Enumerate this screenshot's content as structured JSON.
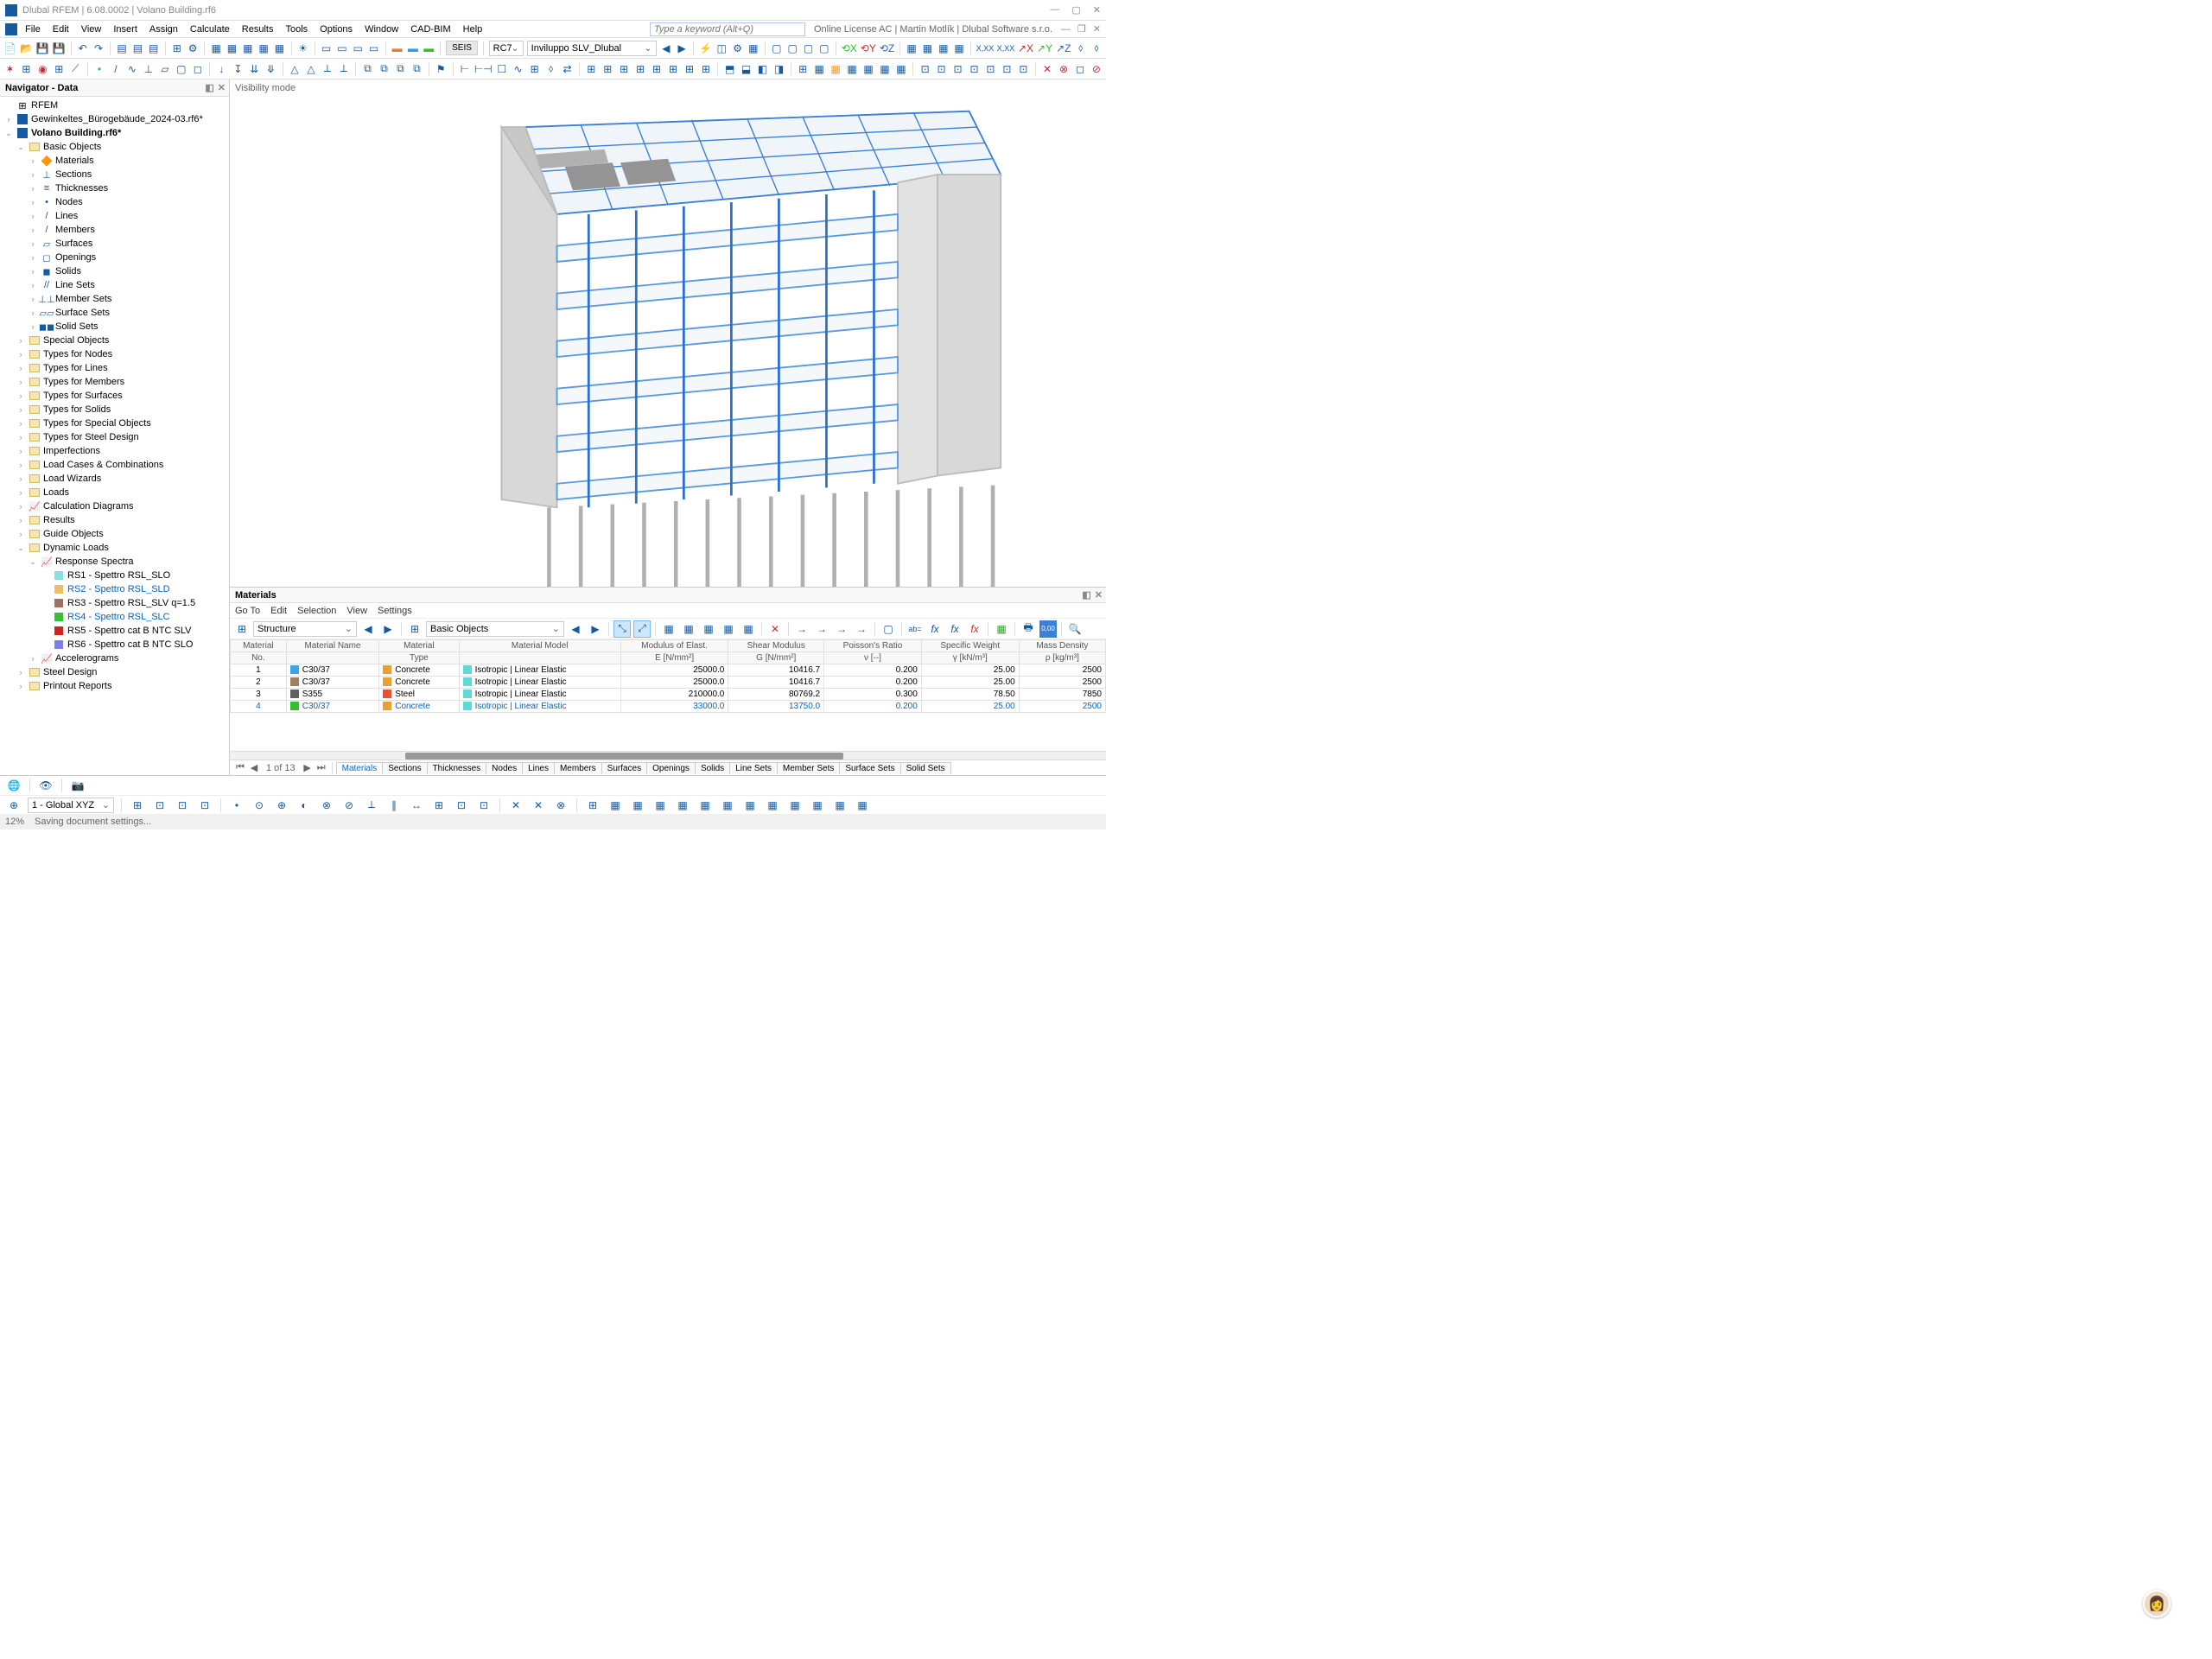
{
  "title": "Dlubal RFEM | 6.08.0002 | Volano Building.rf6",
  "menu": [
    "File",
    "Edit",
    "View",
    "Insert",
    "Assign",
    "Calculate",
    "Results",
    "Tools",
    "Options",
    "Window",
    "CAD-BIM",
    "Help"
  ],
  "keyword_placeholder": "Type a keyword (Alt+Q)",
  "license_info": "Online License AC | Martin Motlík | Dlubal Software s.r.o.",
  "tb1": {
    "seis": "SEIS",
    "rc7": "RC7",
    "combo": "Inviluppo SLV_Dlubal"
  },
  "navigator": {
    "title": "Navigator - Data",
    "root": "RFEM",
    "file1": "Gewinkeltes_Bürogebäude_2024-03.rf6*",
    "file2": "Volano Building.rf6*",
    "basic_objects": "Basic Objects",
    "basic_children": [
      "Materials",
      "Sections",
      "Thicknesses",
      "Nodes",
      "Lines",
      "Members",
      "Surfaces",
      "Openings",
      "Solids",
      "Line Sets",
      "Member Sets",
      "Surface Sets",
      "Solid Sets"
    ],
    "groups": [
      "Special Objects",
      "Types for Nodes",
      "Types for Lines",
      "Types for Members",
      "Types for Surfaces",
      "Types for Solids",
      "Types for Special Objects",
      "Types for Steel Design",
      "Imperfections",
      "Load Cases & Combinations",
      "Load Wizards",
      "Loads",
      "Calculation Diagrams",
      "Results",
      "Guide Objects"
    ],
    "dynamic": "Dynamic Loads",
    "response": "Response Spectra",
    "rs": [
      {
        "label": "RS1 - Spettro RSL_SLO",
        "color": "#89e0e0"
      },
      {
        "label": "RS2 - Spettro RSL_SLD",
        "color": "#eac060",
        "blue": true
      },
      {
        "label": "RS3 - Spettro RSL_SLV q=1.5",
        "color": "#9e7060"
      },
      {
        "label": "RS4 - Spettro RSL_SLC",
        "color": "#32c232",
        "blue": true
      },
      {
        "label": "RS5 - Spettro cat B NTC SLV",
        "color": "#d02020"
      },
      {
        "label": "RS6 - Spettro cat B NTC SLO",
        "color": "#8080e0"
      }
    ],
    "accel": "Accelerograms",
    "rest": [
      "Steel Design",
      "Printout Reports"
    ]
  },
  "viewport_label": "Visibility mode",
  "materials_panel": {
    "title": "Materials",
    "menu": [
      "Go To",
      "Edit",
      "Selection",
      "View",
      "Settings"
    ],
    "combo1": "Structure",
    "combo2": "Basic Objects",
    "headers": [
      "Material\nNo.",
      "Material Name",
      "Material\nType",
      "Material Model",
      "Modulus of Elast.\nE [N/mm²]",
      "Shear Modulus\nG [N/mm²]",
      "Poisson's Ratio\nν [--]",
      "Specific Weight\nγ [kN/m³]",
      "Mass Density\nρ [kg/m³]"
    ],
    "rows": [
      {
        "no": "1",
        "color": "#3aa6e8",
        "name": "C30/37",
        "type": "Concrete",
        "type_c": "#e8a030",
        "model": "Isotropic | Linear Elastic",
        "model_c": "#60d8d8",
        "E": "25000.0",
        "G": "10416.7",
        "v": "0.200",
        "w": "25.00",
        "d": "2500"
      },
      {
        "no": "2",
        "color": "#9e8060",
        "name": "C30/37",
        "type": "Concrete",
        "type_c": "#e8a030",
        "model": "Isotropic | Linear Elastic",
        "model_c": "#60d8d8",
        "E": "25000.0",
        "G": "10416.7",
        "v": "0.200",
        "w": "25.00",
        "d": "2500"
      },
      {
        "no": "3",
        "color": "#606060",
        "name": "S355",
        "type": "Steel",
        "type_c": "#e85030",
        "model": "Isotropic | Linear Elastic",
        "model_c": "#60d8d8",
        "E": "210000.0",
        "G": "80769.2",
        "v": "0.300",
        "w": "78.50",
        "d": "7850"
      },
      {
        "no": "4",
        "color": "#30c030",
        "name": "C30/37",
        "type": "Concrete",
        "type_c": "#e8a030",
        "model": "Isotropic | Linear Elastic",
        "model_c": "#60d8d8",
        "E": "33000.0",
        "G": "13750.0",
        "v": "0.200",
        "w": "25.00",
        "d": "2500",
        "blue": true
      }
    ],
    "page": "1 of 13",
    "tabs": [
      "Materials",
      "Sections",
      "Thicknesses",
      "Nodes",
      "Lines",
      "Members",
      "Surfaces",
      "Openings",
      "Solids",
      "Line Sets",
      "Member Sets",
      "Surface Sets",
      "Solid Sets"
    ]
  },
  "status": {
    "coord": "1 - Global XYZ",
    "pct": "12%",
    "msg": "Saving document settings..."
  }
}
